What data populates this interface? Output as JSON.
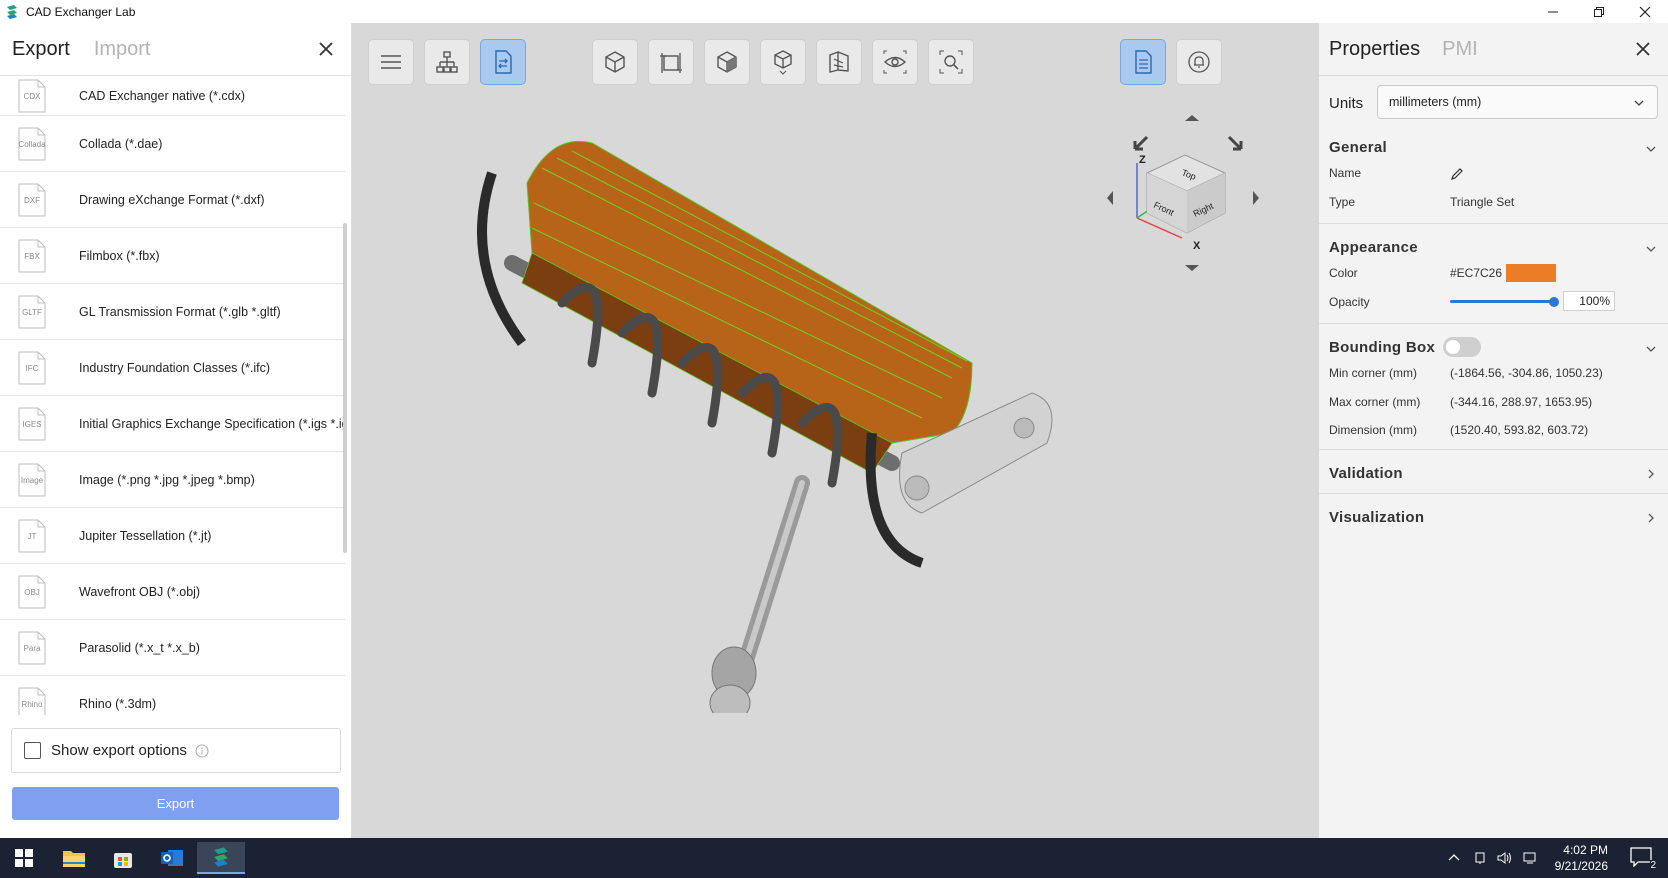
{
  "window": {
    "title": "CAD Exchanger Lab"
  },
  "left_panel": {
    "tabs": {
      "export": "Export",
      "import": "Import"
    },
    "formats": [
      {
        "ext": "CDX",
        "label": "CAD Exchanger native (*.cdx)"
      },
      {
        "ext": "Collada",
        "label": "Collada (*.dae)"
      },
      {
        "ext": "DXF",
        "label": "Drawing eXchange Format (*.dxf)"
      },
      {
        "ext": "FBX",
        "label": "Filmbox (*.fbx)"
      },
      {
        "ext": "GLTF",
        "label": "GL Transmission Format (*.glb *.gltf)"
      },
      {
        "ext": "IFC",
        "label": "Industry Foundation Classes (*.ifc)"
      },
      {
        "ext": "IGES",
        "label": "Initial Graphics Exchange Specification (*.igs *.iges)"
      },
      {
        "ext": "Image",
        "label": "Image (*.png *.jpg *.jpeg *.bmp)"
      },
      {
        "ext": "JT",
        "label": "Jupiter Tessellation (*.jt)"
      },
      {
        "ext": "OBJ",
        "label": "Wavefront OBJ (*.obj)"
      },
      {
        "ext": "Para",
        "label": "Parasolid (*.x_t *.x_b)"
      },
      {
        "ext": "Rhino",
        "label": "Rhino (*.3dm)"
      }
    ],
    "show_export_options": "Show export options",
    "export_button": "Export"
  },
  "viewport": {
    "navcube": {
      "top": "Top",
      "front": "Front",
      "right": "Right",
      "axis_z": "Z",
      "axis_x": "X"
    }
  },
  "right_panel": {
    "tabs": {
      "properties": "Properties",
      "pmi": "PMI"
    },
    "units_label": "Units",
    "units_value": "millimeters (mm)",
    "general": {
      "title": "General",
      "name_label": "Name",
      "type_label": "Type",
      "type_value": "Triangle Set"
    },
    "appearance": {
      "title": "Appearance",
      "color_label": "Color",
      "color_value": "#EC7C26",
      "opacity_label": "Opacity",
      "opacity_value": "100%",
      "opacity_fraction": 1.0
    },
    "bounding_box": {
      "title": "Bounding Box",
      "min_label": "Min corner (mm)",
      "min_value": "(-1864.56, -304.86, 1050.23)",
      "max_label": "Max corner (mm)",
      "max_value": "(-344.16, 288.97, 1653.95)",
      "dim_label": "Dimension (mm)",
      "dim_value": "(1520.40, 593.82, 603.72)"
    },
    "validation": {
      "title": "Validation"
    },
    "visualization": {
      "title": "Visualization"
    }
  },
  "taskbar": {
    "time": "4:02 PM",
    "date": "9/21/2026",
    "notifications": "2"
  },
  "colors": {
    "accent": "#7f9ff0",
    "model_orange": "#EC7C26",
    "model_wire": "#7ad12a"
  }
}
